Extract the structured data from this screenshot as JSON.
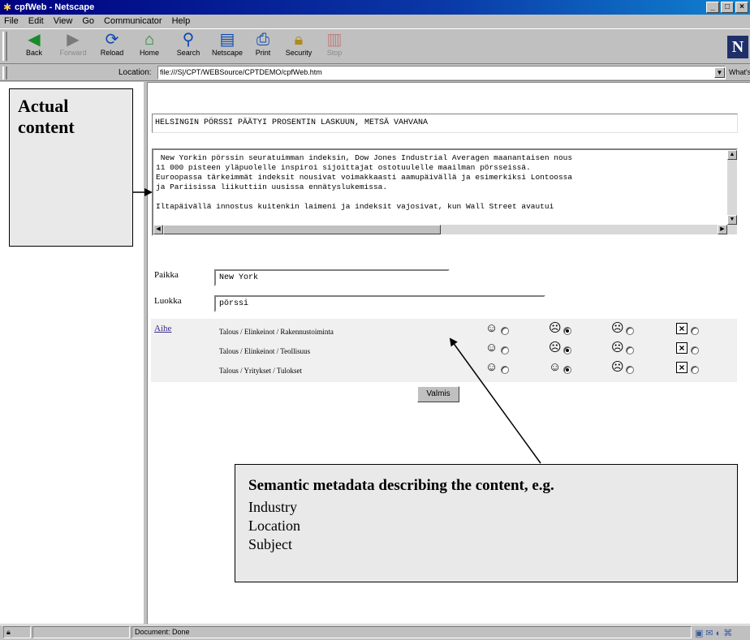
{
  "window": {
    "title": "cpfWeb - Netscape"
  },
  "menu": [
    "File",
    "Edit",
    "View",
    "Go",
    "Communicator",
    "Help"
  ],
  "toolbar": {
    "back": "Back",
    "forward": "Forward",
    "reload": "Reload",
    "home": "Home",
    "search": "Search",
    "netscape": "Netscape",
    "print": "Print",
    "security": "Security",
    "stop": "Stop"
  },
  "location": {
    "label": "Location:",
    "url": "file:///S|/CPT/WEBSource/CPTDEMO/cpfWeb.htm",
    "related": "What's Related"
  },
  "callouts": {
    "actual": [
      "Actual",
      "content"
    ],
    "metadata": {
      "heading": "Semantic metadata describing the content, e.g.",
      "items": [
        "Industry",
        "Location",
        "Subject"
      ]
    }
  },
  "article": {
    "headline": "HELSINGIN PÖRSSI PÄÄTYI PROSENTIN LASKUUN, METSÄ VAHVANA",
    "body_lines": [
      " New Yorkin pörssin seuratuimman indeksin, Dow Jones Industrial Averagen maanantaisen nous",
      "11 000 pisteen yläpuolelle inspiroi sijoittajat ostotuulelle maailman pörsseissä.",
      "Euroopassa tärkeimmät indeksit nousivat voimakkaasti aamupäivällä ja esimerkiksi Lontoossa",
      "ja Pariisissa liikuttiin uusissa ennätyslukemissa.",
      "",
      "Iltapäivällä innostus kuitenkin laimeni ja indeksit vajosivat, kun Wall Street avautui"
    ]
  },
  "form": {
    "place_label": "Paikka",
    "place_value": "New York",
    "class_label": "Luokka",
    "class_value": "pörssi",
    "subject_label": "Aihe",
    "subjects": [
      {
        "label": "Talous / Elinkeinot / Rakennustoiminta",
        "selected": 1
      },
      {
        "label": "Talous / Elinkeinot / Teollisuus",
        "selected": 1
      },
      {
        "label": "Talous / Yritykset / Tulokset",
        "selected": 1
      }
    ],
    "submit": "Valmis"
  },
  "status": {
    "text": "Document: Done"
  }
}
